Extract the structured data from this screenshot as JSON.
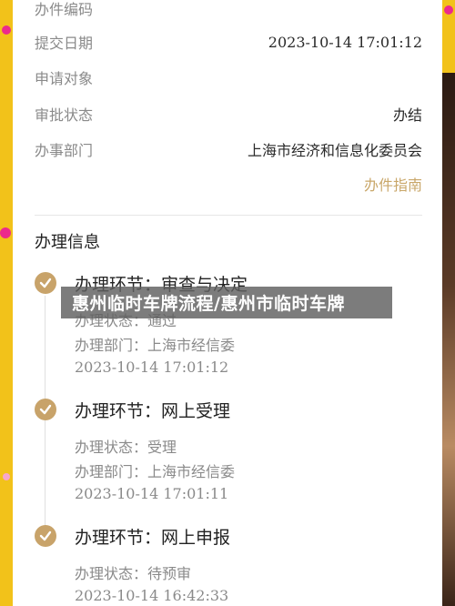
{
  "fields": [
    {
      "label": "办件编码",
      "value": ""
    },
    {
      "label": "提交日期",
      "value": "2023-10-14 17:01:12"
    },
    {
      "label": "申请对象",
      "value": ""
    },
    {
      "label": "审批状态",
      "value": "办结"
    },
    {
      "label": "办事部门",
      "value": "上海市经济和信息化委员会"
    }
  ],
  "guide_link": "办件指南",
  "section_title": "办理信息",
  "steps": [
    {
      "title": "办理环节：审查与决定",
      "status": "办理状态：通过",
      "dept": "办理部门：上海市经信委",
      "time": "2023-10-14 17:01:12"
    },
    {
      "title": "办理环节：网上受理",
      "status": "办理状态：受理",
      "dept": "办理部门：上海市经信委",
      "time": "2023-10-14 17:01:11"
    },
    {
      "title": "办理环节：网上申报",
      "status": "办理状态：待预审",
      "dept": "",
      "time": "2023-10-14 16:42:33"
    }
  ],
  "overlay_text": "惠州临时车牌流程/惠州市临时车牌",
  "colors": {
    "background": "#f2c21a",
    "accent": "#c8a36a",
    "dots": "#ec2a8c"
  },
  "icons": {
    "step": "check-circle-icon"
  }
}
